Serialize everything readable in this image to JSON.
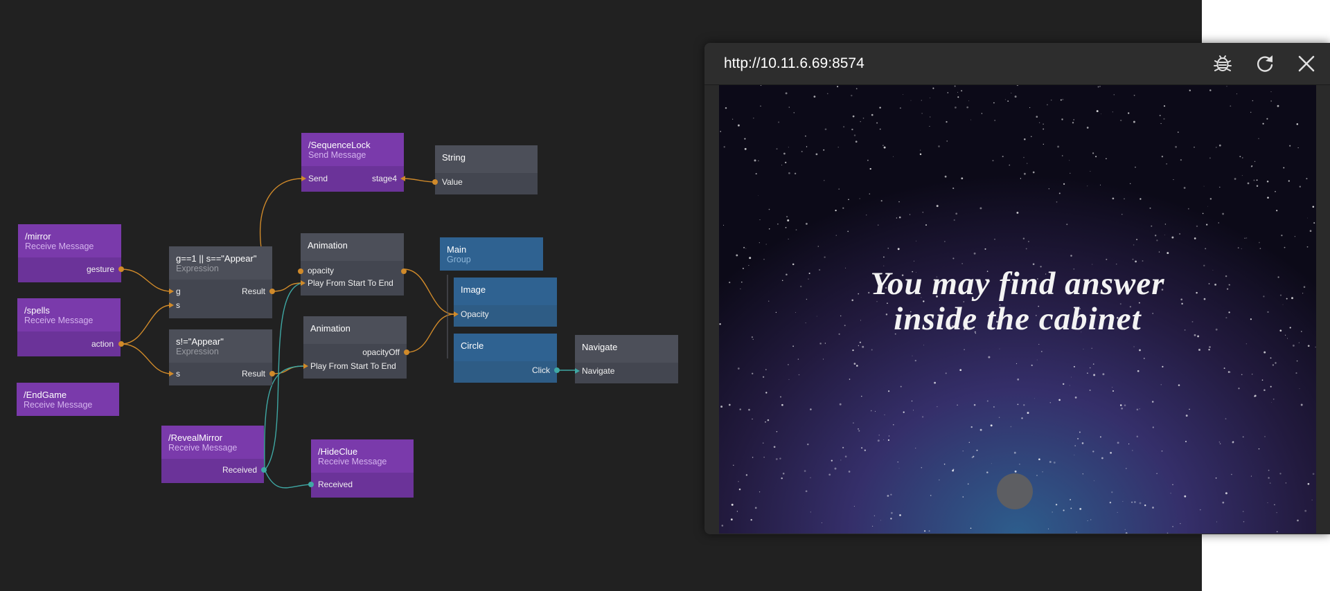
{
  "nodes": {
    "mirror": {
      "title": "/mirror",
      "subtitle": "Receive Message",
      "port": "gesture"
    },
    "spells": {
      "title": "/spells",
      "subtitle": "Receive Message",
      "port": "action"
    },
    "endgame": {
      "title": "/EndGame",
      "subtitle": "Receive Message"
    },
    "expr1": {
      "title": "g==1 || s==\"Appear\"",
      "subtitle": "Expression",
      "in1": "g",
      "in2": "s",
      "out": "Result"
    },
    "expr2": {
      "title": "s!=\"Appear\"",
      "subtitle": "Expression",
      "in1": "s",
      "out": "Result"
    },
    "seqlock": {
      "title": "/SequenceLock",
      "subtitle": "Send Message",
      "in": "Send",
      "port": "stage4"
    },
    "string": {
      "title": "String",
      "port": "Value"
    },
    "anim1": {
      "title": "Animation",
      "out": "opacity",
      "in": "Play From Start To End"
    },
    "anim2": {
      "title": "Animation",
      "out": "opacityOff",
      "in": "Play From Start To End"
    },
    "main": {
      "title": "Main",
      "subtitle": "Group"
    },
    "image": {
      "title": "Image",
      "port": "Opacity"
    },
    "circle": {
      "title": "Circle",
      "port": "Click"
    },
    "navigate": {
      "title": "Navigate",
      "port": "Navigate"
    },
    "revealmirror": {
      "title": "/RevealMirror",
      "subtitle": "Receive Message",
      "port": "Received"
    },
    "hideclue": {
      "title": "/HideClue",
      "subtitle": "Receive Message",
      "port": "Received"
    }
  },
  "preview": {
    "url": "http://10.11.6.69:8574",
    "icons": [
      "bug-icon",
      "refresh-icon",
      "close-icon"
    ],
    "message_line1": "You may find answer",
    "message_line2": "inside the cabinet"
  },
  "colors": {
    "canvas": "#212121",
    "receive_node": "#7237a4",
    "logic_node": "#434650",
    "visual_node": "#2e5c85",
    "signal_wire": "#d08a2a",
    "event_wire": "#3fa8a4"
  }
}
